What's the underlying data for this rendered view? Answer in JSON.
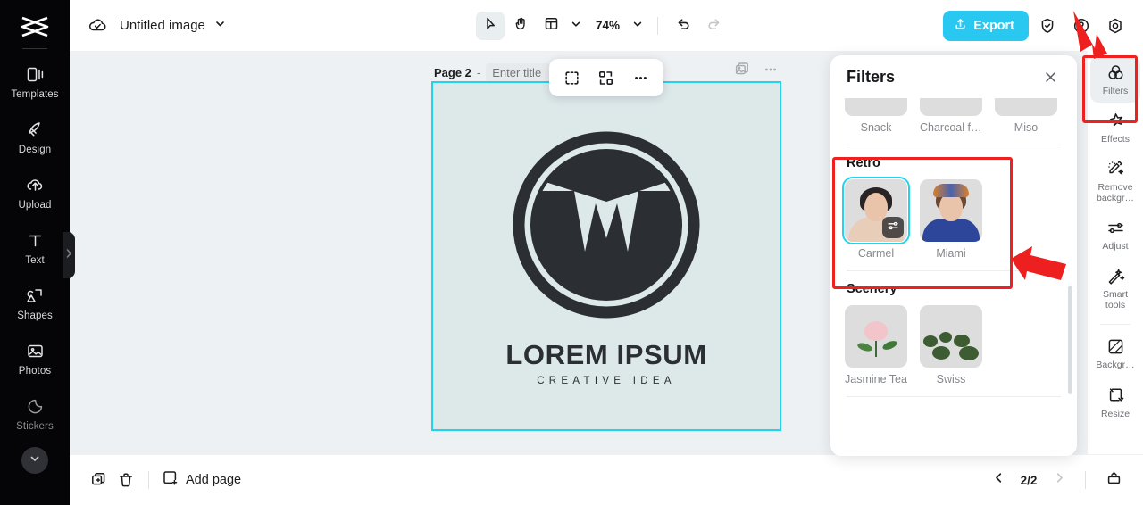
{
  "app": {
    "brand_icon": "capcut-logo-icon",
    "accent_cyan": "#22d3ee",
    "export_color": "#29c8f0",
    "annotation_red": "#ef2020"
  },
  "left_sidebar": {
    "items": [
      {
        "label": "Templates",
        "icon": "templates-icon"
      },
      {
        "label": "Design",
        "icon": "design-icon"
      },
      {
        "label": "Upload",
        "icon": "upload-cloud-icon"
      },
      {
        "label": "Text",
        "icon": "text-icon"
      },
      {
        "label": "Shapes",
        "icon": "shapes-icon"
      },
      {
        "label": "Photos",
        "icon": "photos-icon"
      },
      {
        "label": "Stickers",
        "icon": "stickers-icon"
      }
    ],
    "expand_icon": "chevron-down-icon",
    "collapse_handle_icon": "chevron-right-icon"
  },
  "topbar": {
    "cloud_icon": "cloud-saved-icon",
    "doc_title": "Untitled image",
    "title_chevron": "chevron-down-icon",
    "tools": [
      {
        "name": "select-tool",
        "icon": "cursor-arrow-icon",
        "active": true
      },
      {
        "name": "hand-tool",
        "icon": "hand-icon",
        "active": false
      },
      {
        "name": "layout-tool",
        "icon": "layout-grid-icon",
        "active": false
      }
    ],
    "layout_chevron": "chevron-down-icon",
    "zoom_level": "74%",
    "zoom_chevron": "chevron-down-icon",
    "undo_icon": "undo-arrow-icon",
    "redo_icon": "redo-arrow-icon",
    "export_label": "Export",
    "export_icon": "upload-share-icon",
    "shield_icon": "shield-check-icon",
    "help_icon": "help-circle-icon",
    "settings_icon": "settings-gear-icon"
  },
  "canvas": {
    "page_number_label": "Page 2",
    "dash": "-",
    "title_placeholder": "Enter title",
    "title_value": "",
    "page_actions": [
      {
        "name": "duplicate-page-icon",
        "icon": "duplicate-image-icon"
      },
      {
        "name": "page-more-icon",
        "icon": "more-dots-icon"
      }
    ],
    "float_toolbar": [
      {
        "name": "crop-tool",
        "icon": "crop-select-icon"
      },
      {
        "name": "replace-image-tool",
        "icon": "replace-swap-icon"
      },
      {
        "name": "more-options",
        "icon": "more-dots-icon"
      }
    ],
    "artwork": {
      "title": "LOREM IPSUM",
      "subtitle": "CREATIVE IDEA",
      "background": "#dde8e9",
      "mark_color": "#2b2e32"
    }
  },
  "bottombar": {
    "duplicate_icon": "duplicate-page-icon",
    "delete_icon": "trash-icon",
    "add_page_icon": "add-page-icon",
    "add_page_label": "Add page",
    "prev_icon": "chevron-left-icon",
    "next_icon": "chevron-right-icon",
    "page_indicator": "2/2",
    "present_icon": "present-icon"
  },
  "filters_panel": {
    "title": "Filters",
    "close_icon": "close-x-icon",
    "groups": [
      {
        "name": "",
        "partial": true,
        "items": [
          {
            "label": "Snack",
            "art": "ph-snack",
            "selected": false
          },
          {
            "label": "Charcoal fir…",
            "art": "ph-charcoal",
            "selected": false
          },
          {
            "label": "Miso",
            "art": "ph-miso",
            "selected": false
          }
        ]
      },
      {
        "name": "Retro",
        "partial": false,
        "items": [
          {
            "label": "Carmel",
            "art": "ph-carmel",
            "selected": true,
            "badge_icon": "adjust-sliders-icon"
          },
          {
            "label": "Miami",
            "art": "ph-miami",
            "selected": false
          }
        ]
      },
      {
        "name": "Scenery",
        "partial": false,
        "items": [
          {
            "label": "Jasmine Tea",
            "art": "ph-jasmine",
            "selected": false
          },
          {
            "label": "Swiss",
            "art": "ph-swiss",
            "selected": false
          }
        ]
      }
    ]
  },
  "right_rail": {
    "items": [
      {
        "label": "Filters",
        "icon": "filters-circles-icon",
        "active": true
      },
      {
        "label": "Effects",
        "icon": "effects-sparkle-icon",
        "active": false
      },
      {
        "label": "Remove backgr…",
        "icon": "remove-background-icon",
        "active": false
      },
      {
        "label": "Adjust",
        "icon": "adjust-sliders-icon",
        "active": false
      },
      {
        "label": "Smart tools",
        "icon": "magic-wand-icon",
        "active": false
      },
      {
        "label": "Backgr…",
        "icon": "background-swatch-icon",
        "active": false
      },
      {
        "label": "Resize",
        "icon": "resize-icon",
        "active": false
      }
    ]
  },
  "annotations": {
    "boxes": [
      "filters-tab-highlight",
      "retro-group-highlight"
    ],
    "arrows": [
      "arrow-to-help-icon",
      "arrow-to-retro-group"
    ]
  }
}
